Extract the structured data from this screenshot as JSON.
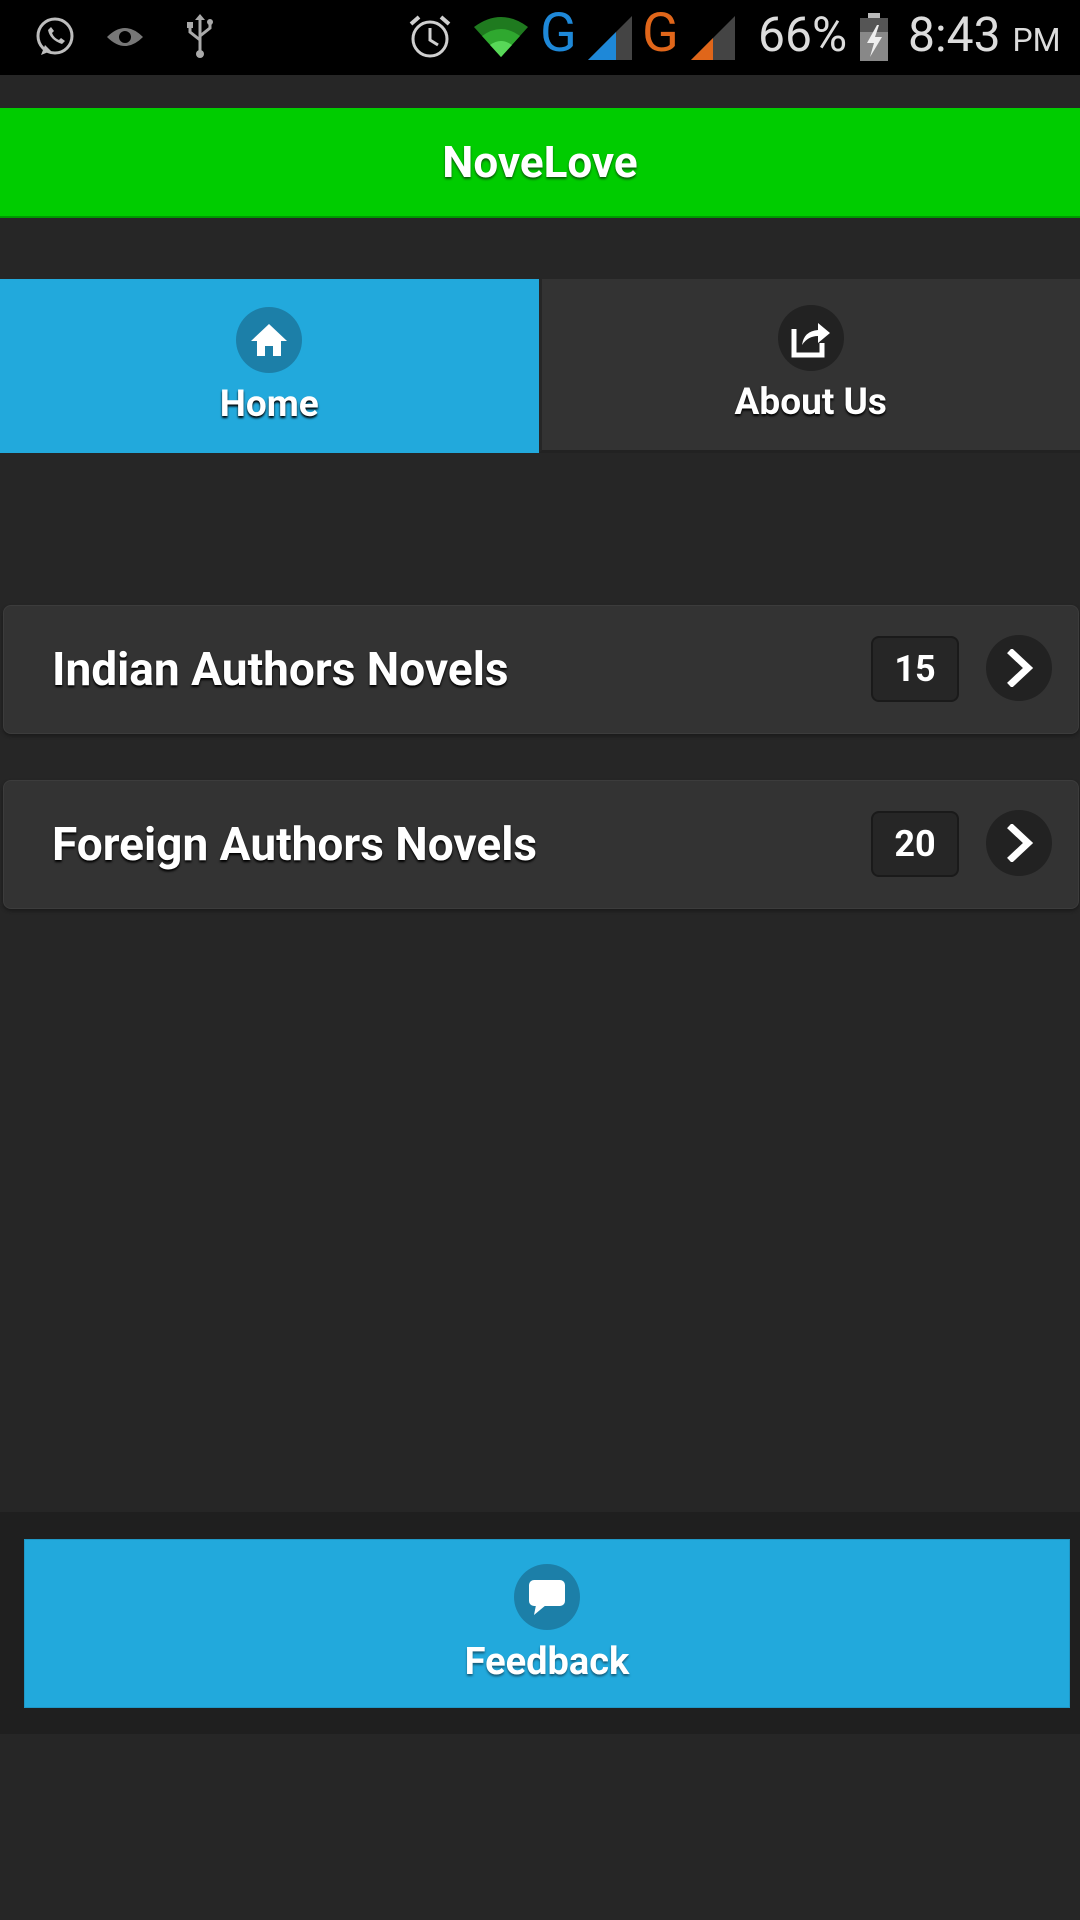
{
  "status_bar": {
    "battery": "66%",
    "time": "8:43",
    "ampm": "PM",
    "icons": [
      "whatsapp-icon",
      "eye-icon",
      "usb-icon",
      "alarm-icon",
      "wifi-icon",
      "network-g-icon",
      "signal-icon",
      "network-g-icon",
      "signal-icon",
      "battery-charging-icon"
    ],
    "network_1": "G",
    "network_2": "G"
  },
  "app": {
    "title": "NoveLove"
  },
  "tabs": [
    {
      "label": "Home",
      "icon": "home-icon",
      "active": true
    },
    {
      "label": "About Us",
      "icon": "share-icon",
      "active": false
    }
  ],
  "list": [
    {
      "label": "Indian Authors Novels",
      "count": "15",
      "icon": "chevron-right-icon"
    },
    {
      "label": "Foreign Authors Novels",
      "count": "20",
      "icon": "chevron-right-icon"
    }
  ],
  "footer": {
    "feedback_label": "Feedback",
    "icon": "chat-bubble-icon"
  },
  "colors": {
    "header": "#00cc00",
    "accent": "#22a9dc",
    "background": "#262626",
    "network_1": "#1e88d8",
    "network_2": "#e0661a"
  }
}
